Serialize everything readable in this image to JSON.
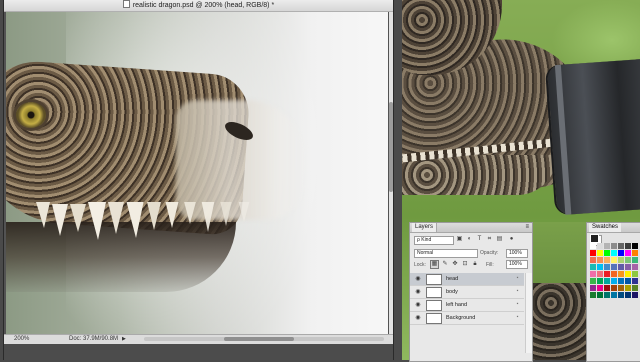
{
  "document": {
    "title": "realistic dragon.psd @ 200% (head, RGB/8) *",
    "status": {
      "zoom": "200%",
      "doc_size": "Doc: 37.9M/90.8M"
    }
  },
  "layers_panel": {
    "tab_label": "Layers",
    "kind_filter": "ρ Kind",
    "blend_mode": "Normal",
    "opacity_label": "Opacity:",
    "opacity_value": "100%",
    "lock_label": "Lock:",
    "fill_label": "Fill:",
    "fill_value": "100%",
    "layers": [
      {
        "name": "head",
        "selected": true
      },
      {
        "name": "body",
        "selected": false
      },
      {
        "name": "left hand",
        "selected": false
      },
      {
        "name": "Background",
        "selected": false
      }
    ]
  },
  "swatches_panel": {
    "tab_label": "Swatches",
    "colors": [
      "#ffffff",
      "#dcdcdc",
      "#b4b4b4",
      "#8c8c8c",
      "#646464",
      "#3c3c3c",
      "#000000",
      "#ff0000",
      "#ffff00",
      "#00ff00",
      "#00ffff",
      "#0000ff",
      "#ff00ff",
      "#ff7f00",
      "#f26c4f",
      "#f68e55",
      "#fbaf5c",
      "#fff467",
      "#acd372",
      "#7cc576",
      "#3bb878",
      "#1abbb4",
      "#00bff3",
      "#438ccb",
      "#5574b9",
      "#605ca8",
      "#855fa8",
      "#a763a8",
      "#f06ea9",
      "#f26d7d",
      "#ed1c24",
      "#f26522",
      "#f7941d",
      "#fff200",
      "#8dc73f",
      "#39b54a",
      "#00a651",
      "#00a99d",
      "#00aeef",
      "#0072bc",
      "#0054a6",
      "#2e3192",
      "#92278f",
      "#ec008c",
      "#9e0b0f",
      "#a0410d",
      "#a36209",
      "#aba000",
      "#598527",
      "#1a7b30",
      "#007236",
      "#00746b",
      "#0076a3",
      "#004b80",
      "#003471",
      "#1b1464"
    ]
  }
}
